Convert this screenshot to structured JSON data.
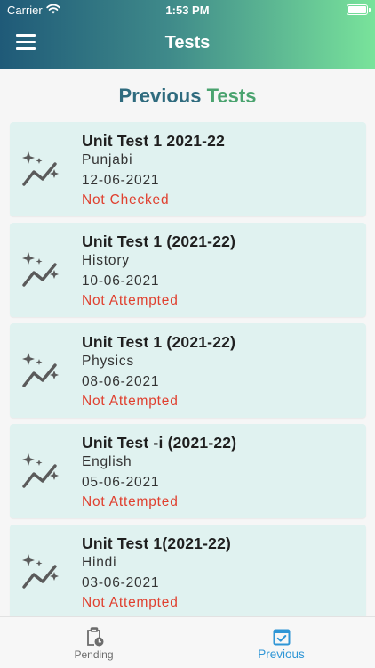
{
  "status_bar": {
    "carrier": "Carrier",
    "time": "1:53 PM"
  },
  "header": {
    "title": "Tests",
    "menu_icon": "hamburger-menu-icon"
  },
  "page": {
    "title_part1": "Previous",
    "title_part2": "Tests",
    "title_color_part1": "#2f6b7e",
    "title_color_part2": "#4aa36f"
  },
  "tests": [
    {
      "title": "Unit Test 1 2021-22",
      "subject": "Punjabi",
      "date": "12-06-2021",
      "status": "Not Checked"
    },
    {
      "title": "Unit Test 1 (2021-22)",
      "subject": "History",
      "date": "10-06-2021",
      "status": "Not Attempted"
    },
    {
      "title": "Unit Test 1 (2021-22)",
      "subject": "Physics",
      "date": "08-06-2021",
      "status": "Not Attempted"
    },
    {
      "title": "Unit Test -i (2021-22)",
      "subject": "English",
      "date": "05-06-2021",
      "status": "Not Attempted"
    },
    {
      "title": "Unit Test 1(2021-22)",
      "subject": "Hindi",
      "date": "03-06-2021",
      "status": "Not Attempted"
    }
  ],
  "bottom_nav": {
    "items": [
      {
        "label": "Pending",
        "icon": "clipboard-clock-icon",
        "active": false
      },
      {
        "label": "Previous",
        "icon": "calendar-check-icon",
        "active": true
      }
    ]
  },
  "colors": {
    "status_text": "#e0402f",
    "card_background": "#e0f2f0",
    "active_nav": "#2f96d6"
  }
}
